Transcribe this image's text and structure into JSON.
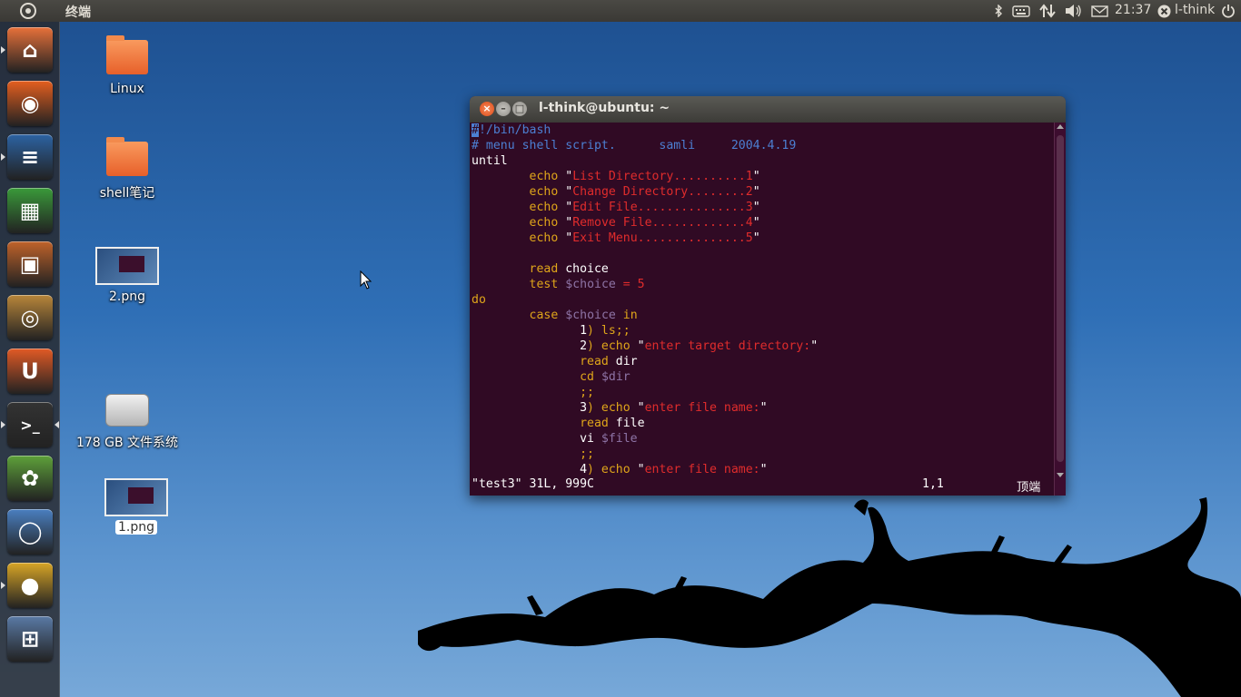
{
  "top_panel": {
    "app_title": "终端",
    "clock": "21:37",
    "user": "l-think",
    "icons": [
      "bluetooth-icon",
      "keyboard-icon",
      "network-icon",
      "volume-icon",
      "mail-icon",
      "power-icon"
    ]
  },
  "launcher": {
    "items": [
      {
        "name": "home-folder",
        "glyph": "⌂",
        "color": "#e8713a"
      },
      {
        "name": "firefox",
        "glyph": "◉",
        "color": "#e55f1f"
      },
      {
        "name": "libreoffice-writer",
        "glyph": "≡",
        "color": "#2c63a3"
      },
      {
        "name": "libreoffice-calc",
        "glyph": "▦",
        "color": "#3a9a3a"
      },
      {
        "name": "libreoffice-impress",
        "glyph": "▣",
        "color": "#c0632a"
      },
      {
        "name": "software-center",
        "glyph": "◎",
        "color": "#b8863a"
      },
      {
        "name": "ubuntu-one",
        "glyph": "U",
        "color": "#e25a25"
      },
      {
        "name": "terminal",
        "glyph": ">_",
        "color": "#333333"
      },
      {
        "name": "shotwell",
        "glyph": "✿",
        "color": "#5ea13a"
      },
      {
        "name": "chromium",
        "glyph": "◯",
        "color": "#4a7fc0"
      },
      {
        "name": "chrome",
        "glyph": "●",
        "color": "#d8a526"
      },
      {
        "name": "workspaces",
        "glyph": "⊞",
        "color": "#5a7aa5"
      }
    ]
  },
  "desktop": {
    "folder1": "Linux",
    "folder2": "shell笔记",
    "image1": "2.png",
    "drive": "178 GB 文件系统",
    "image2": "1.png"
  },
  "terminal": {
    "title": "l-think@ubuntu: ~",
    "lines": [
      [
        {
          "t": "#",
          "c": "cursor"
        },
        {
          "t": "!/bin/bash",
          "c": "cmt"
        }
      ],
      [
        {
          "t": "# menu shell script.      samli     2004.4.19",
          "c": "cmt"
        }
      ],
      [
        {
          "t": "until",
          "c": ""
        }
      ],
      [
        {
          "t": "        ",
          "c": ""
        },
        {
          "t": "echo",
          "c": "kw"
        },
        {
          "t": " \"",
          "c": ""
        },
        {
          "t": "List Directory..........1",
          "c": "str"
        },
        {
          "t": "\"",
          "c": ""
        }
      ],
      [
        {
          "t": "        ",
          "c": ""
        },
        {
          "t": "echo",
          "c": "kw"
        },
        {
          "t": " \"",
          "c": ""
        },
        {
          "t": "Change Directory........2",
          "c": "str"
        },
        {
          "t": "\"",
          "c": ""
        }
      ],
      [
        {
          "t": "        ",
          "c": ""
        },
        {
          "t": "echo",
          "c": "kw"
        },
        {
          "t": " \"",
          "c": ""
        },
        {
          "t": "Edit File...............3",
          "c": "str"
        },
        {
          "t": "\"",
          "c": ""
        }
      ],
      [
        {
          "t": "        ",
          "c": ""
        },
        {
          "t": "echo",
          "c": "kw"
        },
        {
          "t": " \"",
          "c": ""
        },
        {
          "t": "Remove File.............4",
          "c": "str"
        },
        {
          "t": "\"",
          "c": ""
        }
      ],
      [
        {
          "t": "        ",
          "c": ""
        },
        {
          "t": "echo",
          "c": "kw"
        },
        {
          "t": " \"",
          "c": ""
        },
        {
          "t": "Exit Menu...............5",
          "c": "str"
        },
        {
          "t": "\"",
          "c": ""
        }
      ],
      [
        {
          "t": "",
          "c": ""
        }
      ],
      [
        {
          "t": "        ",
          "c": ""
        },
        {
          "t": "read",
          "c": "kw"
        },
        {
          "t": " choice",
          "c": ""
        }
      ],
      [
        {
          "t": "        ",
          "c": ""
        },
        {
          "t": "test",
          "c": "kw"
        },
        {
          "t": " ",
          "c": ""
        },
        {
          "t": "$choice",
          "c": "var"
        },
        {
          "t": " = 5",
          "c": "str"
        }
      ],
      [
        {
          "t": "do",
          "c": "kw"
        }
      ],
      [
        {
          "t": "        ",
          "c": ""
        },
        {
          "t": "case",
          "c": "kw"
        },
        {
          "t": " ",
          "c": ""
        },
        {
          "t": "$choice",
          "c": "var"
        },
        {
          "t": " ",
          "c": ""
        },
        {
          "t": "in",
          "c": "kw"
        }
      ],
      [
        {
          "t": "               1",
          "c": ""
        },
        {
          "t": ") ls;;",
          "c": "kw"
        }
      ],
      [
        {
          "t": "               2",
          "c": ""
        },
        {
          "t": ") echo",
          "c": "kw"
        },
        {
          "t": " \"",
          "c": ""
        },
        {
          "t": "enter target directory:",
          "c": "str"
        },
        {
          "t": "\"",
          "c": ""
        }
      ],
      [
        {
          "t": "               ",
          "c": ""
        },
        {
          "t": "read",
          "c": "kw"
        },
        {
          "t": " dir",
          "c": ""
        }
      ],
      [
        {
          "t": "               ",
          "c": ""
        },
        {
          "t": "cd",
          "c": "kw"
        },
        {
          "t": " ",
          "c": ""
        },
        {
          "t": "$dir",
          "c": "var"
        }
      ],
      [
        {
          "t": "               ;;",
          "c": "kw"
        }
      ],
      [
        {
          "t": "               3",
          "c": ""
        },
        {
          "t": ") echo",
          "c": "kw"
        },
        {
          "t": " \"",
          "c": ""
        },
        {
          "t": "enter file name:",
          "c": "str"
        },
        {
          "t": "\"",
          "c": ""
        }
      ],
      [
        {
          "t": "               ",
          "c": ""
        },
        {
          "t": "read",
          "c": "kw"
        },
        {
          "t": " file",
          "c": ""
        }
      ],
      [
        {
          "t": "               vi ",
          "c": ""
        },
        {
          "t": "$file",
          "c": "var"
        }
      ],
      [
        {
          "t": "               ;;",
          "c": "kw"
        }
      ],
      [
        {
          "t": "               4",
          "c": ""
        },
        {
          "t": ") echo",
          "c": "kw"
        },
        {
          "t": " \"",
          "c": ""
        },
        {
          "t": "enter file name:",
          "c": "str"
        },
        {
          "t": "\"",
          "c": ""
        }
      ]
    ],
    "status_file": "\"test3\" 31L, 999C",
    "status_pos": "1,1",
    "status_scroll": "顶端"
  }
}
